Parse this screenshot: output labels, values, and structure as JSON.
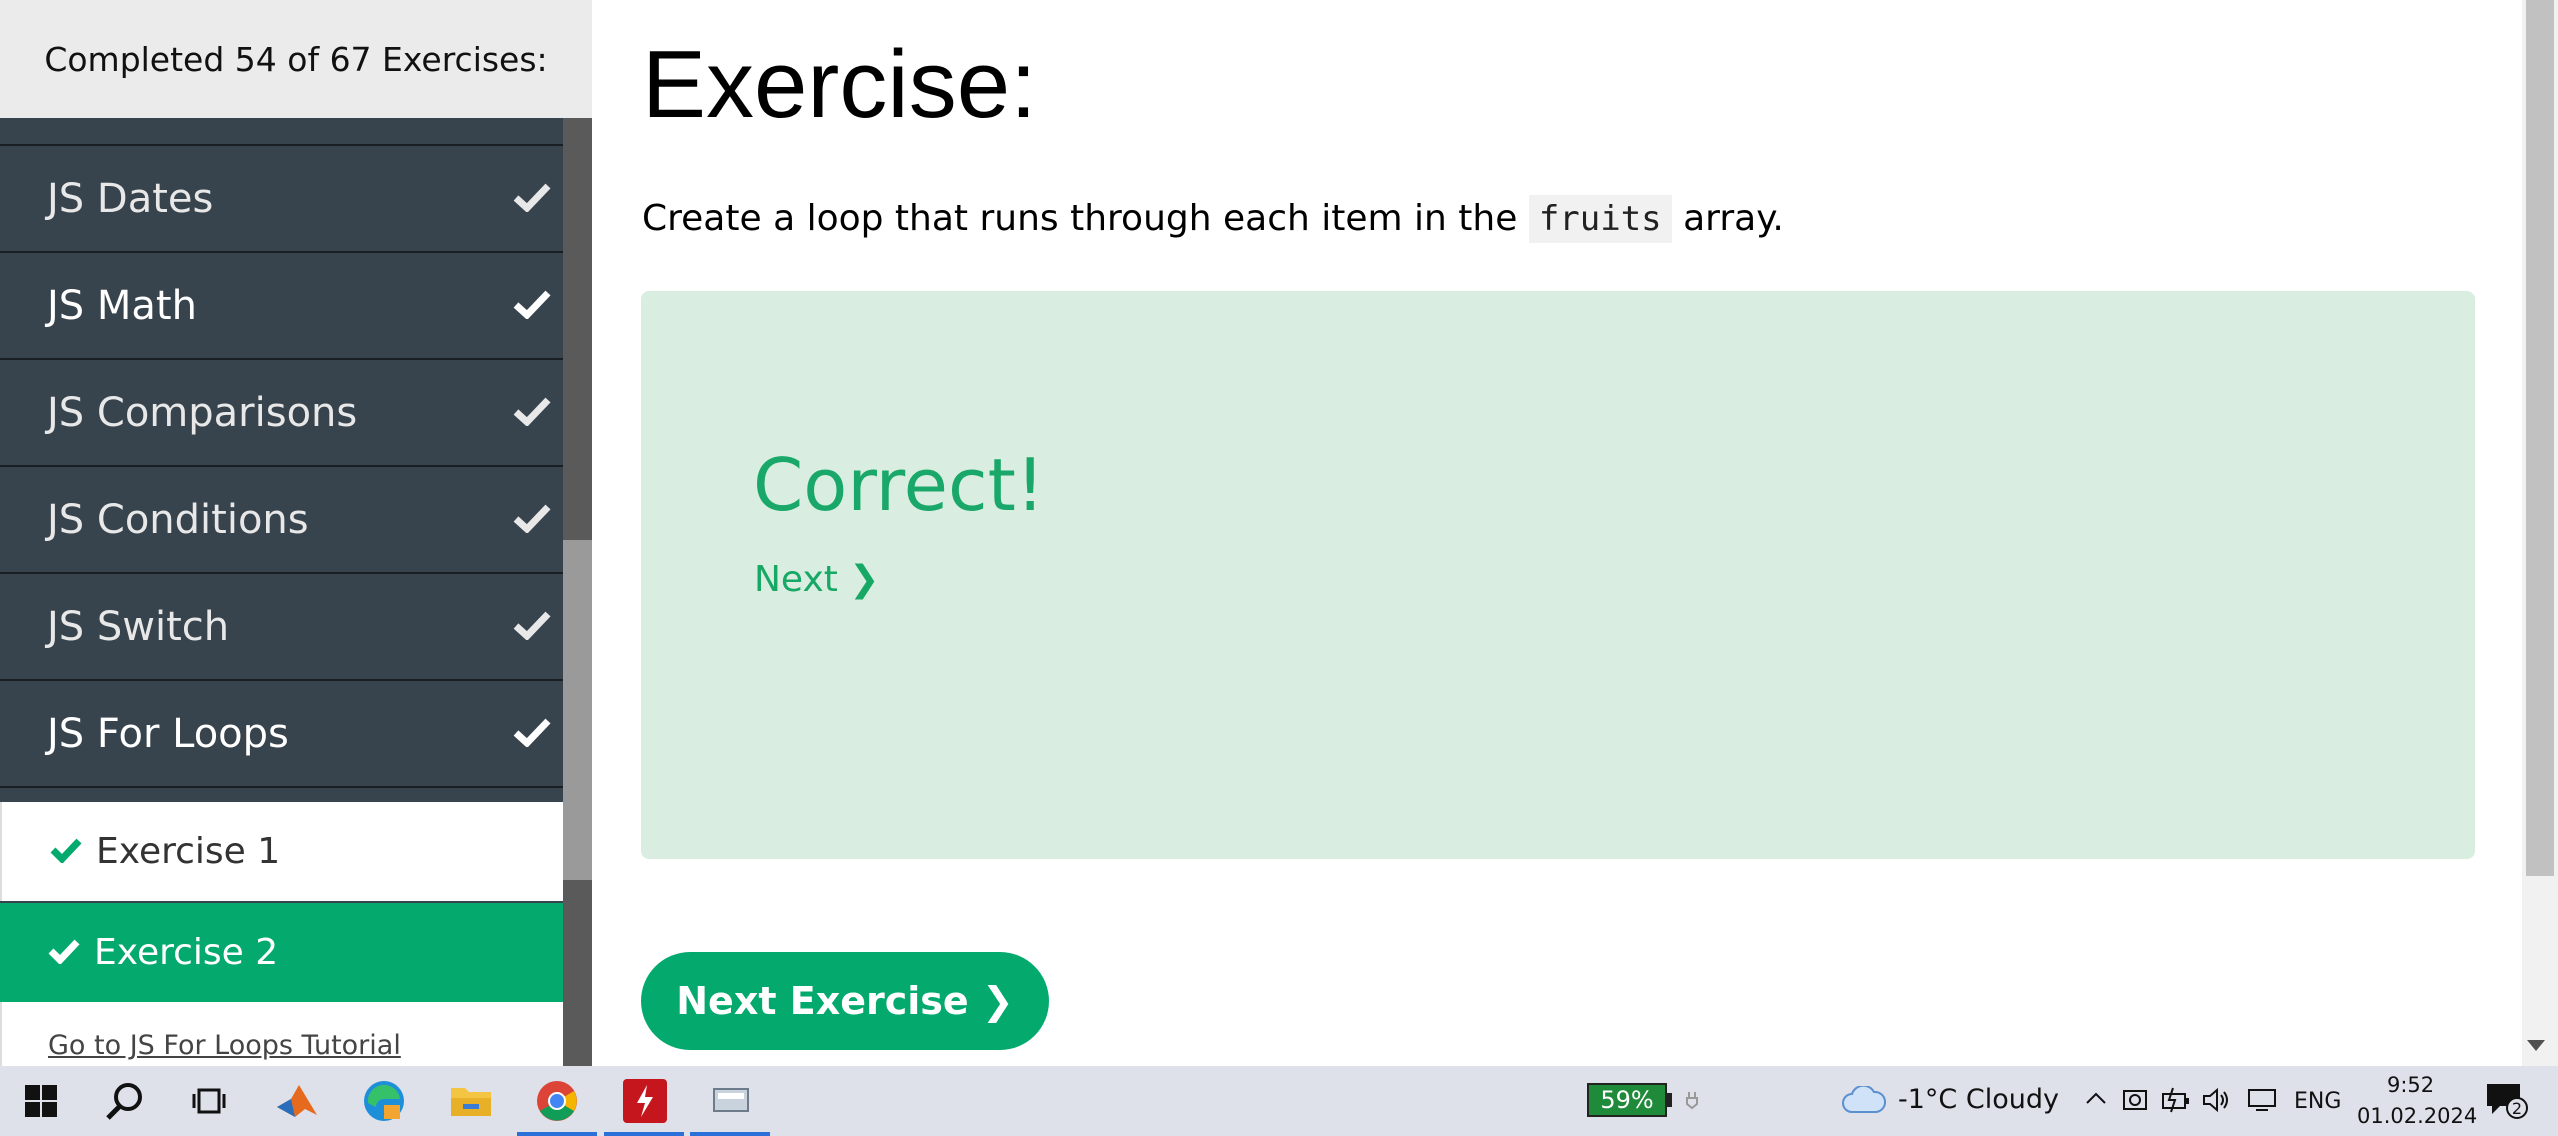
{
  "sidebar": {
    "header": "Completed 54 of 67 Exercises:",
    "items": [
      {
        "label": "JS Dates"
      },
      {
        "label": "JS Math"
      },
      {
        "label": "JS Comparisons"
      },
      {
        "label": "JS Conditions"
      },
      {
        "label": "JS Switch"
      },
      {
        "label": "JS For Loops"
      }
    ],
    "sub_items": [
      {
        "label": "Exercise 1"
      },
      {
        "label": "Exercise 2"
      }
    ],
    "tutorial_link": "Go to JS For Loops Tutorial"
  },
  "main": {
    "title": "Exercise:",
    "instruction_before": "Create a loop that runs through each item in the ",
    "instruction_code": "fruits",
    "instruction_after": " array.",
    "result_title": "Correct!",
    "next_link": "Next ❯",
    "next_exercise_button": "Next Exercise ❯"
  },
  "taskbar": {
    "battery": "59%",
    "weather": "-1°C  Cloudy",
    "language": "ENG",
    "time": "9:52",
    "date": "01.02.2024",
    "notification_count": "2",
    "apps": [
      "start-icon",
      "search-icon",
      "task-view-icon",
      "matlab-icon",
      "edge-icon",
      "file-explorer-icon",
      "chrome-icon",
      "acrobat-icon",
      "app-icon"
    ]
  },
  "colors": {
    "accent_green": "#04aa6d",
    "sidebar_dark": "#38444d",
    "result_bg": "#d9eee1"
  }
}
